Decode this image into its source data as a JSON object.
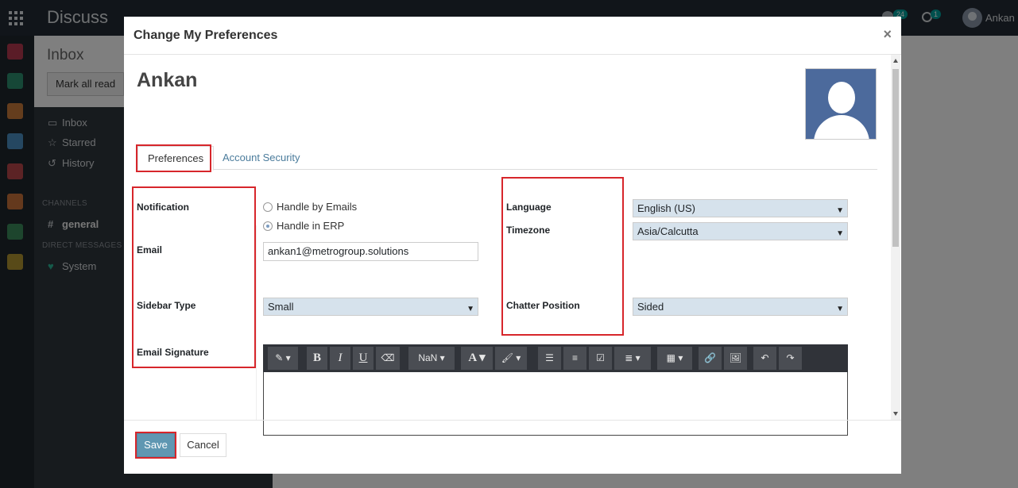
{
  "topbar": {
    "app_title": "Discuss",
    "messages_count": "24",
    "activities_count": "1",
    "user_name": "Ankan"
  },
  "control": {
    "breadcrumb": "Inbox",
    "mark_all_read_label": "Mark all read"
  },
  "sidebar": {
    "items": [
      {
        "label": "Inbox",
        "icon": "inbox-icon"
      },
      {
        "label": "Starred",
        "icon": "star-icon"
      },
      {
        "label": "History",
        "icon": "history-icon"
      }
    ],
    "channels_heading": "CHANNELS",
    "channels": [
      {
        "label": "general",
        "icon": "hash-icon"
      }
    ],
    "dm_heading": "DIRECT MESSAGES",
    "direct_messages": [
      {
        "label": "System",
        "icon": "heart-icon"
      }
    ]
  },
  "modal": {
    "title": "Change My Preferences",
    "close_symbol": "×",
    "record_name": "Ankan",
    "tabs": [
      {
        "label": "Preferences",
        "active": true
      },
      {
        "label": "Account Security",
        "active": false
      }
    ],
    "fields": {
      "notification_label": "Notification",
      "notification_options": [
        {
          "label": "Handle by Emails",
          "selected": false
        },
        {
          "label": "Handle in ERP",
          "selected": true
        }
      ],
      "email_label": "Email",
      "email_value": "ankan1@metrogroup.solutions",
      "sidebar_type_label": "Sidebar Type",
      "sidebar_type_value": "Small",
      "email_signature_label": "Email Signature",
      "language_label": "Language",
      "language_value": "English (US)",
      "timezone_label": "Timezone",
      "timezone_value": "Asia/Calcutta",
      "chatter_position_label": "Chatter Position",
      "chatter_position_value": "Sided"
    },
    "editor_toolbar": {
      "font_size_label": "NaN"
    },
    "footer": {
      "save_label": "Save",
      "cancel_label": "Cancel"
    }
  },
  "colors": {
    "topbar": "#232b34",
    "accent": "#5f97b2",
    "highlight_box": "#d7262b",
    "link": "#4b7c9c"
  }
}
